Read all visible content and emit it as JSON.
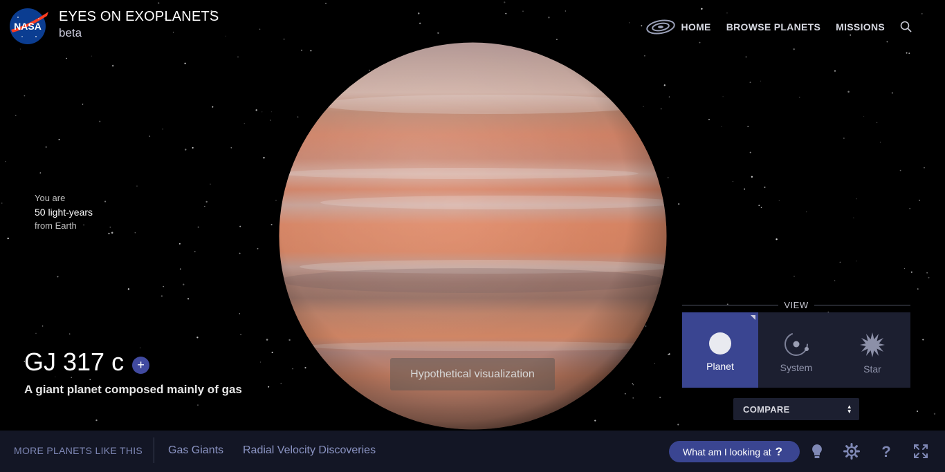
{
  "header": {
    "title": "EYES ON EXOPLANETS",
    "subtitle": "beta",
    "logo_text": "NASA",
    "nav": [
      {
        "label": "HOME"
      },
      {
        "label": "BROWSE PLANETS"
      },
      {
        "label": "MISSIONS"
      }
    ]
  },
  "distance": {
    "line1": "You are",
    "value": "50 light-years",
    "line3": "from Earth"
  },
  "planet": {
    "name": "GJ 317 c",
    "add_symbol": "+",
    "description": "A giant planet composed mainly of gas",
    "note": "Hypothetical visualization"
  },
  "view": {
    "heading": "VIEW",
    "options": [
      {
        "label": "Planet",
        "icon": "planet-icon",
        "active": true
      },
      {
        "label": "System",
        "icon": "system-icon",
        "active": false
      },
      {
        "label": "Star",
        "icon": "star-icon",
        "active": false
      }
    ],
    "compare_label": "COMPARE"
  },
  "footer": {
    "more_label": "MORE PLANETS LIKE THIS",
    "tags": [
      "Gas Giants",
      "Radial Velocity Discoveries"
    ],
    "help_label": "What am I looking at",
    "help_symbol": "?"
  },
  "colors": {
    "accent": "#3a4591",
    "footer_bg": "#131625",
    "panel_bg": "#1c1f30"
  }
}
